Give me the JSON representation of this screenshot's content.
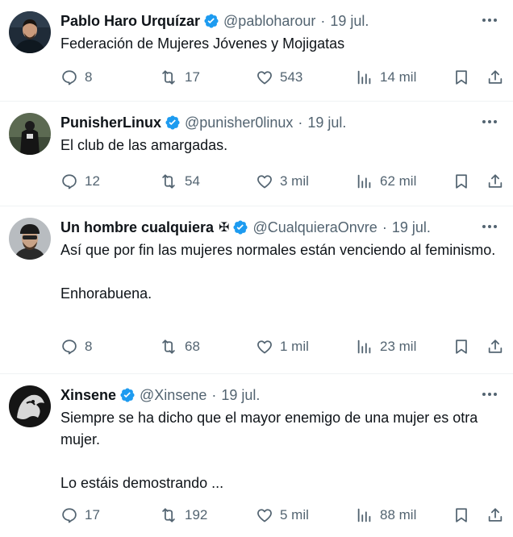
{
  "colors": {
    "text": "#0f1419",
    "secondary": "#536471",
    "verified": "#1d9bf0",
    "divider": "#eff3f4"
  },
  "icons": {
    "reply": "speech-bubble-icon",
    "retweet": "retweet-arrows-icon",
    "like": "heart-icon",
    "views": "bar-chart-icon",
    "bookmark": "bookmark-icon",
    "share": "share-upload-icon",
    "more": "more-dots-icon",
    "verified": "verified-badge-icon"
  },
  "tweets": [
    {
      "name": "Pablo Haro Urquízar",
      "handle": "@pabloharour",
      "separator": "·",
      "date": "19 jul.",
      "lines": [
        "Federación de Mujeres Jóvenes y Mojigatas"
      ],
      "replies": "8",
      "retweets": "17",
      "likes": "543",
      "views": "14 mil"
    },
    {
      "name": "PunisherLinux",
      "handle": "@punisher0linux",
      "separator": "·",
      "date": "19 jul.",
      "lines": [
        "El club de las amargadas."
      ],
      "replies": "12",
      "retweets": "54",
      "likes": "3 mil",
      "views": "62 mil"
    },
    {
      "name": "Un hombre cualquiera",
      "name_symbol": "✠",
      "handle": "@CualquieraOnvre",
      "separator": "·",
      "date": "19 jul.",
      "lines": [
        "Así que por fin las mujeres normales están venciendo al feminismo.",
        "Enhorabuena."
      ],
      "replies": "8",
      "retweets": "68",
      "likes": "1 mil",
      "views": "23 mil"
    },
    {
      "name": "Xinsene",
      "handle": "@Xinsene",
      "separator": "·",
      "date": "19 jul.",
      "lines": [
        "Siempre se ha dicho que el mayor enemigo de una mujer es otra mujer.",
        "Lo estáis demostrando ..."
      ],
      "replies": "17",
      "retweets": "192",
      "likes": "5 mil",
      "views": "88 mil"
    }
  ]
}
